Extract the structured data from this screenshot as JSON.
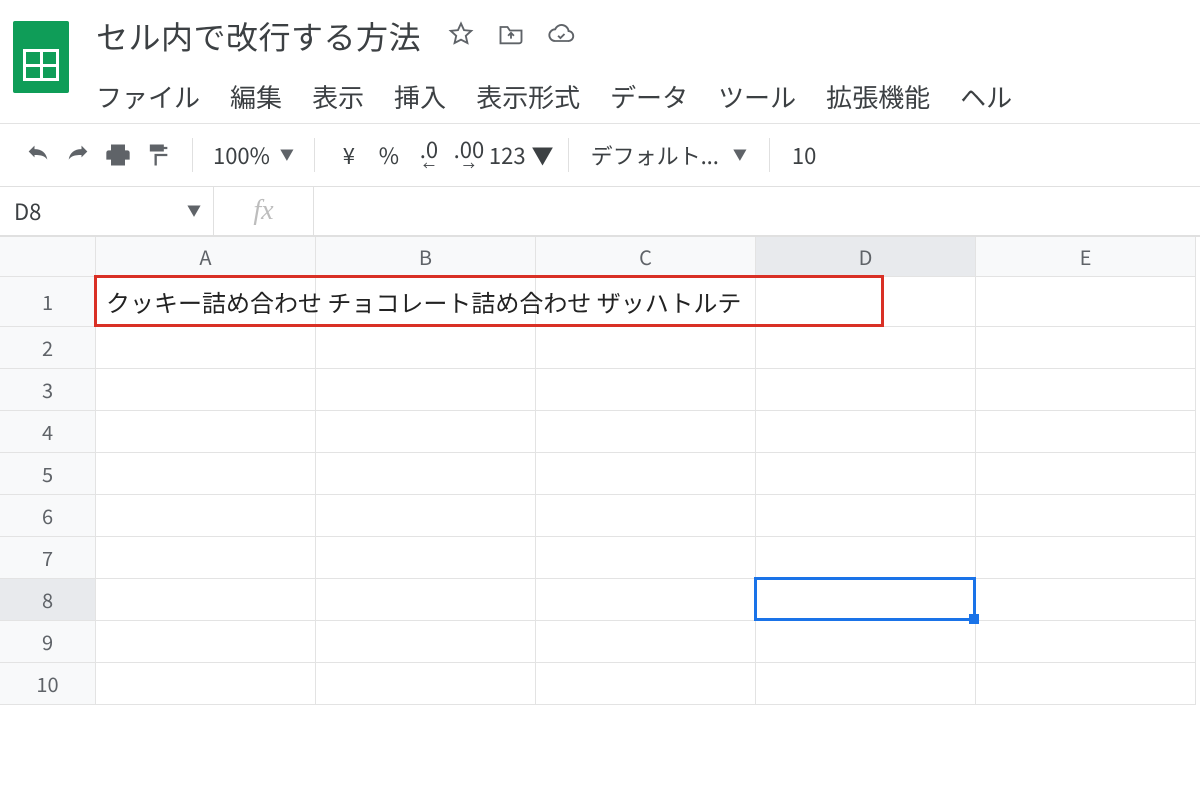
{
  "header": {
    "title": "セル内で改行する方法",
    "icons": {
      "star": "star-icon",
      "move": "move-to-drive-icon",
      "cloud": "cloud-saved-icon"
    }
  },
  "menus": [
    "ファイル",
    "編集",
    "表示",
    "挿入",
    "表示形式",
    "データ",
    "ツール",
    "拡張機能",
    "ヘル"
  ],
  "toolbar": {
    "zoom": "100%",
    "currency": "¥",
    "percent": "%",
    "dec_dec": ".0",
    "inc_dec": ".00",
    "fmt123": "123",
    "font": "デフォルト...",
    "font_size": "10"
  },
  "namebox": {
    "value": "D8"
  },
  "fx_symbol": "fx",
  "columns": [
    "A",
    "B",
    "C",
    "D",
    "E"
  ],
  "rows": [
    "1",
    "2",
    "3",
    "4",
    "5",
    "6",
    "7",
    "8",
    "9",
    "10"
  ],
  "active_col": "D",
  "active_row": "8",
  "cells": {
    "A1": "クッキー詰め合わせ チョコレート詰め合わせ ザッハトルテ"
  }
}
